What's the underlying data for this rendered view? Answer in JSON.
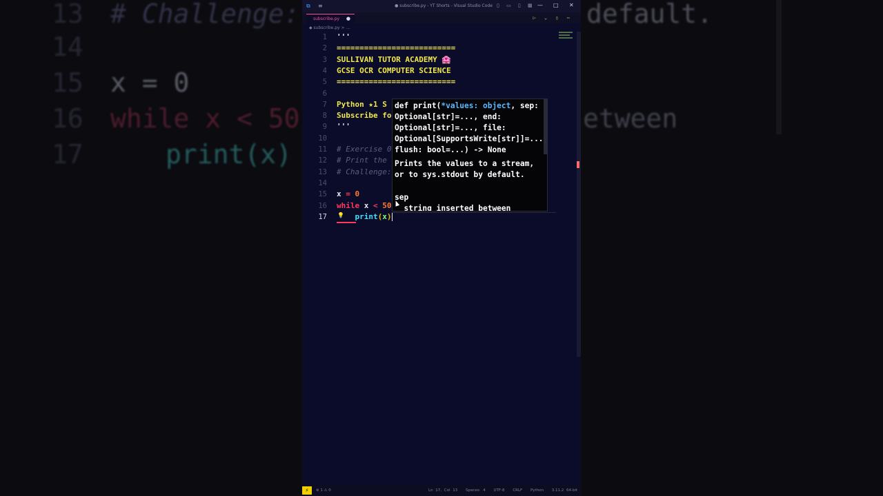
{
  "background": {
    "lines": [
      {
        "ln": "13",
        "text": "# Challenge: ",
        "right": "default."
      },
      {
        "ln": "14",
        "text": "",
        "right": ""
      },
      {
        "ln": "15",
        "text": "x = 0",
        "right": ""
      },
      {
        "ln": "16",
        "text": "while x < 50",
        "right": "etween"
      },
      {
        "ln": "17",
        "text": "print(x)",
        "right": ""
      }
    ]
  },
  "window": {
    "title": "● subscribe.py - YT Shorts - Visual Studio Code",
    "vs_icon": "vscode-logo-icon",
    "menu_icon": "hamburger-menu-icon",
    "layout_icons": "▯ ▭ ▯ ▦",
    "minimize": "—",
    "maximize": "□",
    "close": "✕"
  },
  "tab": {
    "label": "subscribe.py",
    "modified_dot": "●"
  },
  "run_icons": "▷ ⌄ ▯ ⋯",
  "breadcrumb": "◆ subscribe.py > ...",
  "editor": {
    "lines": [
      {
        "n": "1",
        "text": "'''"
      },
      {
        "n": "2",
        "text": "=========================="
      },
      {
        "n": "3",
        "text": "SULLIVAN TUTOR ACADEMY 🏩"
      },
      {
        "n": "4",
        "text": "GCSE OCR COMPUTER SCIENCE"
      },
      {
        "n": "5",
        "text": "=========================="
      },
      {
        "n": "6",
        "text": ""
      },
      {
        "n": "7",
        "text": "Python ★1 S"
      },
      {
        "n": "8",
        "text": "Subscribe fo"
      },
      {
        "n": "9",
        "text": "'''"
      },
      {
        "n": "10",
        "text": ""
      },
      {
        "n": "11",
        "text": "# Exercise 0"
      },
      {
        "n": "12",
        "text": "# Print the "
      },
      {
        "n": "13",
        "text": "# Challenge:"
      },
      {
        "n": "14",
        "text": ""
      },
      {
        "n": "15",
        "text": "x = 0"
      },
      {
        "n": "16",
        "text": "while x < 50"
      },
      {
        "n": "17",
        "text": "    print(x)"
      }
    ],
    "line15": {
      "var": "x",
      "op": " = ",
      "num": "0"
    },
    "line16": {
      "kw": "while",
      "var": " x ",
      "op": "<",
      "num": " 50"
    },
    "line17": {
      "indent": "    ",
      "fn": "print",
      "open": "(",
      "arg": "x",
      "close": ")"
    }
  },
  "hover": {
    "sig": [
      {
        "a": "def print(",
        "b": "*values: object",
        "c": ", sep:"
      },
      {
        "a": "Optional[str]=..., end:",
        "b": "",
        "c": ""
      },
      {
        "a": "Optional[str]=..., file:",
        "b": "",
        "c": ""
      },
      {
        "a": "Optional[SupportsWrite[str]]=...,",
        "b": "",
        "c": ""
      },
      {
        "a": "flush: bool=...) -> None",
        "b": "",
        "c": ""
      }
    ],
    "doc": [
      "Prints the values to a stream,",
      "or to sys.stdout by default.",
      "",
      "sep",
      "  string inserted between"
    ]
  },
  "status": {
    "remote": "⚡",
    "problems": "⊗ 1  ⚠ 0",
    "items": [
      "Ln 17, Col 13",
      "Spaces: 4",
      "UTF-8",
      "CRLF",
      "Python",
      "3.11.2 64-bit",
      "⚲",
      "🔔"
    ]
  },
  "colors": {
    "accent_pink": "#ff4f9a",
    "code_yellow": "#f0e84a",
    "keyword_red": "#ff3b5c",
    "editor_bg": "#0b0b2a"
  }
}
